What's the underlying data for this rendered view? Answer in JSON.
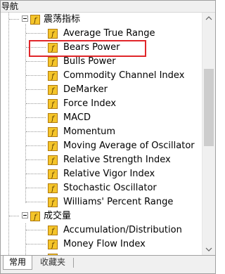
{
  "window": {
    "title": "导航"
  },
  "tree": {
    "groups": [
      {
        "label": "震荡指标",
        "expanded": true,
        "items": [
          {
            "label": "Average True Range"
          },
          {
            "label": "Bears Power",
            "highlighted": true
          },
          {
            "label": "Bulls Power"
          },
          {
            "label": "Commodity Channel Index"
          },
          {
            "label": "DeMarker"
          },
          {
            "label": "Force Index"
          },
          {
            "label": "MACD"
          },
          {
            "label": "Momentum"
          },
          {
            "label": "Moving Average of Oscillator"
          },
          {
            "label": "Relative Strength Index"
          },
          {
            "label": "Relative Vigor Index"
          },
          {
            "label": "Stochastic Oscillator"
          },
          {
            "label": "Williams' Percent Range"
          }
        ]
      },
      {
        "label": "成交量",
        "expanded": true,
        "items": [
          {
            "label": "Accumulation/Distribution"
          },
          {
            "label": "Money Flow Index"
          }
        ]
      }
    ],
    "icon": "indicator-function-icon"
  },
  "tabs": [
    {
      "label": "常用",
      "active": true
    },
    {
      "label": "收藏夹",
      "active": false
    }
  ],
  "colors": {
    "highlight_border": "#e0262a",
    "icon_fill": "#f5c52a",
    "icon_border": "#b07a10"
  }
}
